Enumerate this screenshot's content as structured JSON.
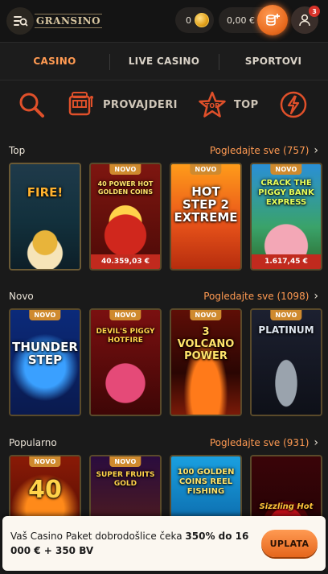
{
  "header": {
    "logo_text": "GRANSINO",
    "coins_value": "0",
    "balance": "0,00 €",
    "notification_count": "3"
  },
  "nav": {
    "tabs": [
      {
        "label": "CASINO",
        "active": true
      },
      {
        "label": "LIVE CASINO",
        "active": false
      },
      {
        "label": "SPORTOVI",
        "active": false
      }
    ]
  },
  "categories": [
    {
      "label": "",
      "icon": "search-icon"
    },
    {
      "label": "PROVAJDERI",
      "icon": "slot-machine-icon"
    },
    {
      "label": "TOP",
      "icon": "star-icon"
    },
    {
      "label": "",
      "icon": "lightning-icon"
    }
  ],
  "sections": {
    "top": {
      "title": "Top",
      "link": "Pogledajte sve (757)",
      "games": [
        {
          "name": "FIRE!",
          "novo": false,
          "jackpot": ""
        },
        {
          "name": "40 POWER HOT GOLDEN COINS",
          "novo": true,
          "jackpot": "40.359,03 €"
        },
        {
          "name": "HOT STEP 2 EXTREME",
          "novo": true,
          "jackpot": ""
        },
        {
          "name": "CRACK THE PIGGY BANK EXPRESS",
          "novo": true,
          "jackpot": "1.617,45 €"
        }
      ]
    },
    "novo": {
      "title": "Novo",
      "link": "Pogledajte sve (1098)",
      "games": [
        {
          "name": "THUNDER STEP",
          "novo": true
        },
        {
          "name": "DEVIL'S PIGGY HOTFIRE",
          "novo": true
        },
        {
          "name": "3 VOLCANO POWER",
          "novo": true
        },
        {
          "name": "PLATINUM",
          "novo": true
        }
      ]
    },
    "popularno": {
      "title": "Popularno",
      "link": "Pogledajte sve (931)",
      "games": [
        {
          "name": "40",
          "novo": true
        },
        {
          "name": "SUPER FRUITS GOLD",
          "novo": true
        },
        {
          "name": "100 GOLDEN COINS REEL FISHING",
          "novo": false
        },
        {
          "name": "Sizzling Hot",
          "novo": false
        }
      ]
    }
  },
  "promo": {
    "text_before": "Vaš Casino Paket dobrodošlice čeka ",
    "text_bold": "350% do 16 000 € + 350 BV",
    "button": "UPLATA"
  },
  "colors": {
    "accent": "#ff9a52",
    "background": "#1a1a1a",
    "novo_badge": "#cf8a2e",
    "jackpot_bar": "#c12a1e"
  }
}
